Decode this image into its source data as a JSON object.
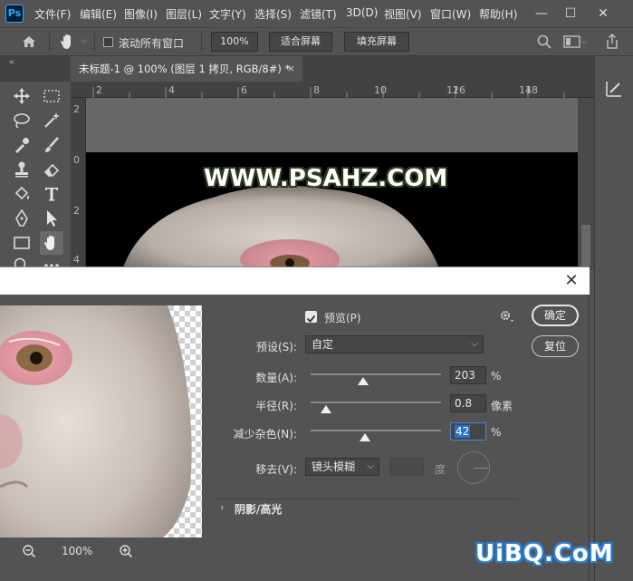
{
  "app": {
    "logo": "Ps"
  },
  "menu": [
    "文件(F)",
    "编辑(E)",
    "图像(I)",
    "图层(L)",
    "文字(Y)",
    "选择(S)",
    "滤镜(T)",
    "3D(D)",
    "视图(V)",
    "窗口(W)",
    "帮助(H)"
  ],
  "window_controls": {
    "minimize": "—",
    "maximize": "☐",
    "close": "✕"
  },
  "options": {
    "scroll_all_label": "滚动所有窗口",
    "zoom_value": "100%",
    "fit_screen": "适合屏幕",
    "fill_screen": "填充屏幕"
  },
  "document_tab": {
    "title": "未标题-1 @ 100% (图层 1 拷贝, RGB/8#) *",
    "close": "×"
  },
  "ruler_h": [
    "2",
    "4",
    "6",
    "8",
    "10",
    "12",
    "14",
    "16",
    "18"
  ],
  "ruler_v": [
    "2",
    "0",
    "2",
    "4"
  ],
  "canvas_text": "WWW.PSAHZ.COM",
  "dialog": {
    "close": "✕",
    "preview_label": "预览(P)",
    "preview_checked": true,
    "ok": "确定",
    "reset": "复位",
    "preset_label": "预设(S):",
    "preset_value": "自定",
    "amount": {
      "label": "数量(A):",
      "value": "203",
      "unit": "%",
      "fraction": 0.4
    },
    "radius": {
      "label": "半径(R):",
      "value": "0.8",
      "unit": "像素",
      "fraction": 0.12
    },
    "noise": {
      "label": "减少杂色(N):",
      "value": "42",
      "unit": "%",
      "fraction": 0.42
    },
    "remove": {
      "label": "移去(V):",
      "value": "镜头模糊",
      "angle_unit": "度"
    },
    "shadows_highlights": "阴影/高光",
    "zoom_level": "100%"
  },
  "watermark": "UiBQ.CoM",
  "colors": {
    "panel": "#535353",
    "dark": "#424242",
    "highlight": "#2a7fd4"
  }
}
